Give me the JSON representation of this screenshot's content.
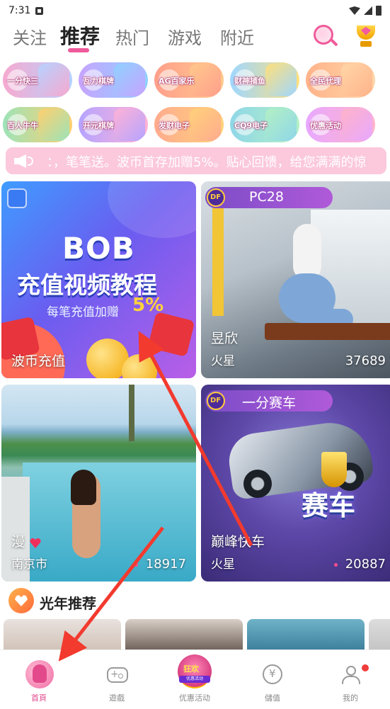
{
  "status": {
    "time": "7:31"
  },
  "nav": {
    "tabs": [
      {
        "label": "关注",
        "active": false
      },
      {
        "label": "推荐",
        "active": true
      },
      {
        "label": "热门",
        "active": false
      },
      {
        "label": "游戏",
        "active": false
      },
      {
        "label": "附近",
        "active": false
      }
    ],
    "search_icon": "search-icon",
    "trophy_icon": "trophy-icon"
  },
  "games": [
    {
      "label": "一分快三",
      "color_a": "#f7a9cf",
      "color_b": "#b6d1ff"
    },
    {
      "label": "瓦力棋牌",
      "color_a": "#c7a4ff",
      "color_b": "#8fd1ff"
    },
    {
      "label": "AG百家乐",
      "color_a": "#ff9f8b",
      "color_b": "#ffc98c"
    },
    {
      "label": "财神捕鱼",
      "color_a": "#9fd7ff",
      "color_b": "#ffe07b"
    },
    {
      "label": "全民代理",
      "color_a": "#ffb38a",
      "color_b": "#ffd6a8"
    },
    {
      "label": "百人牛牛",
      "color_a": "#9ce3b8",
      "color_b": "#ffcf6e"
    },
    {
      "label": "开元棋牌",
      "color_a": "#b6a4ff",
      "color_b": "#ffb2d6"
    },
    {
      "label": "发财电子",
      "color_a": "#ffab8e",
      "color_b": "#ffd27a"
    },
    {
      "label": "CQ9电子",
      "color_a": "#8fd7e8",
      "color_b": "#b3f0c4"
    },
    {
      "label": "优惠活动",
      "color_a": "#e8a8ff",
      "color_b": "#ffb3c8"
    }
  ],
  "marquee": {
    "text": "：，笔笔送。波币首存加赠5%。贴心回馈，给您满满的惊"
  },
  "cards": [
    {
      "id": "bob",
      "title_big": "BOB",
      "title_sub": "充值视频教程",
      "promo_text": "每笔充值加赠",
      "promo_pct": "5%",
      "name": "波币充值"
    },
    {
      "id": "pc28",
      "badge": "PC28",
      "name": "昱欣",
      "location": "火星",
      "count": "37689"
    },
    {
      "id": "beach",
      "name": "漫",
      "location": "南京市",
      "count": "18917"
    },
    {
      "id": "race",
      "badge": "一分赛车",
      "overlay_text": "赛车",
      "name": "巅峰快车",
      "location": "火星",
      "count": "20887"
    }
  ],
  "section": {
    "title": "光年推荐"
  },
  "bottom_nav": [
    {
      "label": "首頁",
      "active": true,
      "icon": "home-icon"
    },
    {
      "label": "遊戲",
      "active": false,
      "icon": "gamepad-icon"
    },
    {
      "label": "优惠活动",
      "active": false,
      "icon": "promo-icon",
      "promo_text": "狂欢",
      "promo_band": "优惠活动"
    },
    {
      "label": "儲值",
      "active": false,
      "icon": "wallet-icon"
    },
    {
      "label": "我的",
      "active": false,
      "icon": "user-icon"
    }
  ],
  "colors": {
    "accent": "#ef5a9b",
    "arrow": "#f23a2e"
  }
}
